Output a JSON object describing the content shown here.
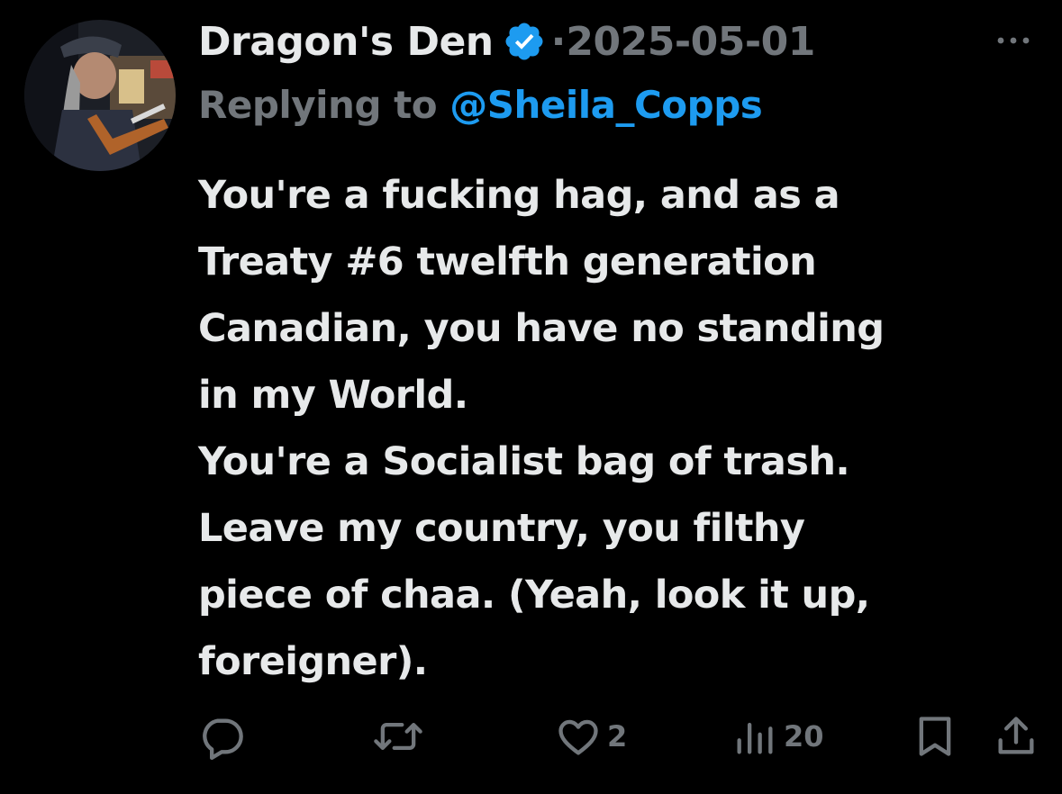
{
  "tweet": {
    "display_name": "Dragon's Den",
    "separator": "·",
    "date": "2025-05-01",
    "replying_prefix": "Replying to",
    "replying_handle": "@Sheila_Copps",
    "body_lines": [
      "You're a fucking hag, and as a",
      "Treaty #6 twelfth generation",
      "Canadian, you have no standing",
      "in my World.",
      "You're a Socialist bag of trash.",
      "Leave my country, you filthy",
      "piece of chaa. (Yeah, look it up,",
      "foreigner)."
    ]
  },
  "actions": {
    "reply_icon": "reply-icon",
    "retweet_icon": "retweet-icon",
    "like_icon": "heart-icon",
    "like_count": "2",
    "views_icon": "views-icon",
    "views_count": "20",
    "bookmark_icon": "bookmark-icon",
    "share_icon": "share-icon"
  },
  "icons": {
    "verified": "verified-badge-icon",
    "more": "more-icon"
  },
  "colors": {
    "background": "#000000",
    "text": "#e7e9ea",
    "muted": "#71767b",
    "accent": "#1d9bf0"
  }
}
